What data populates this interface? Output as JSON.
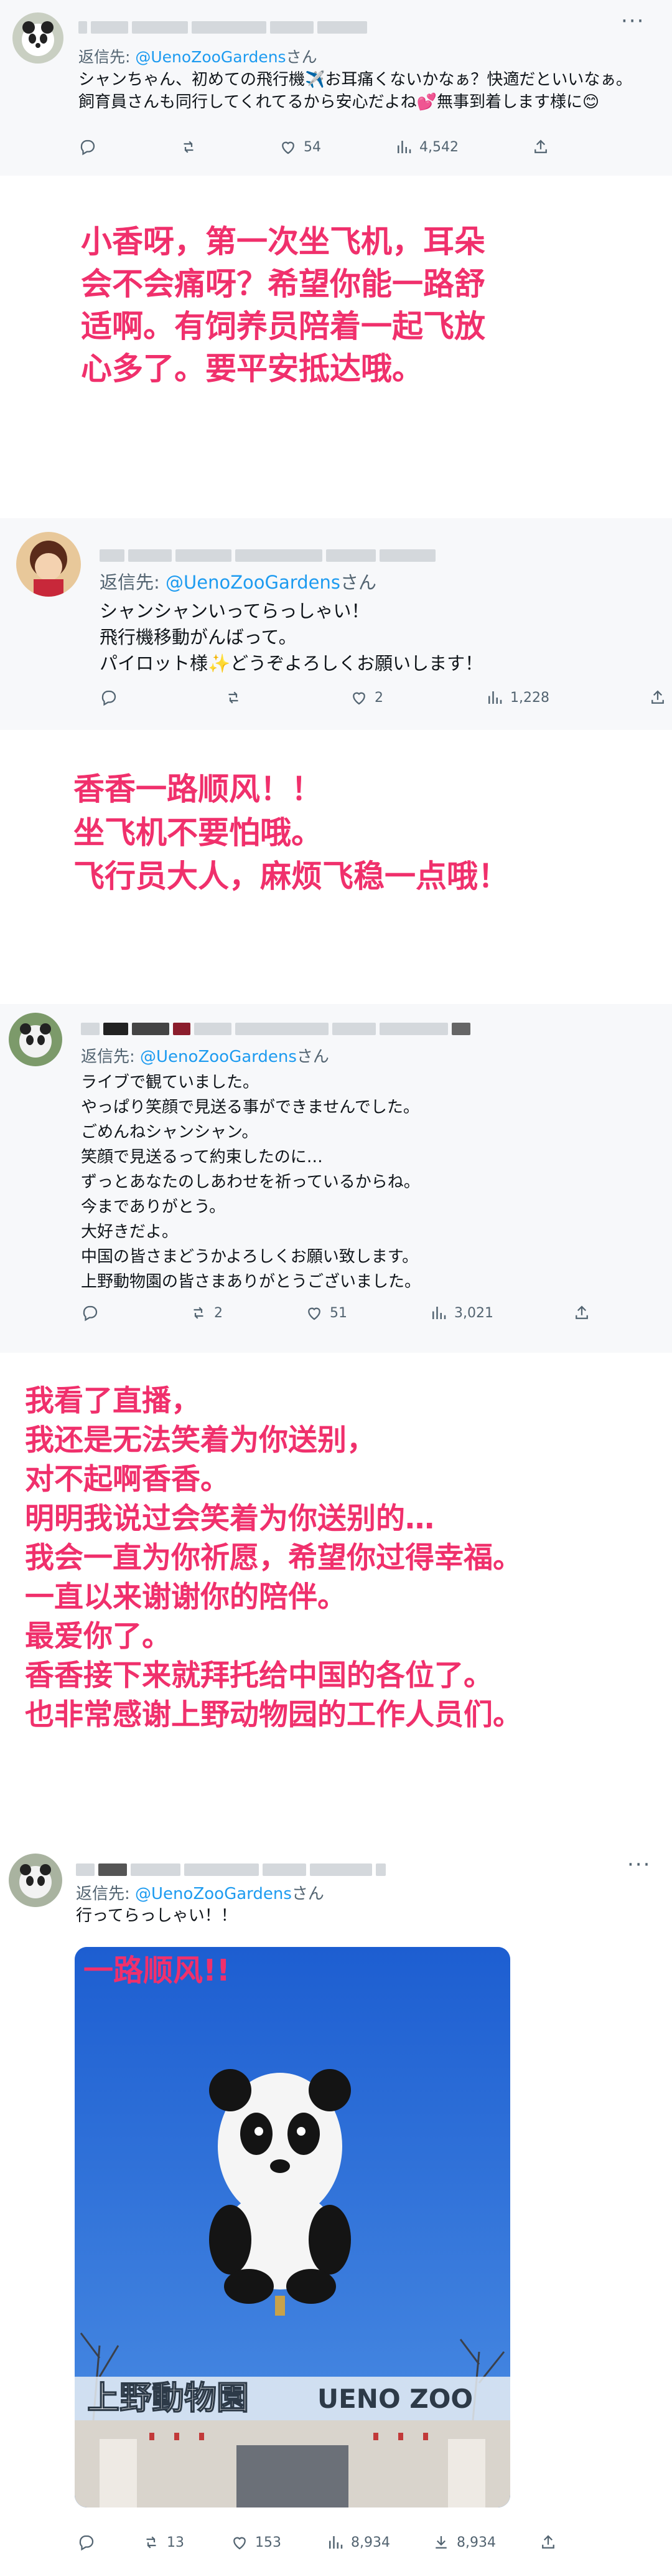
{
  "tweets": [
    {
      "reply_prefix": "返信先: ",
      "reply_handle": "@UenoZooGardens",
      "reply_suffix": "さん",
      "body": "シャンちゃん、初めての飛行機✈️お耳痛くないかなぁ？快適だといいなぁ。飼育員さんも同行してくれてるから安心だよね💕無事到着します様に😊",
      "more": "···",
      "replies": "",
      "retweets": "",
      "likes": "54",
      "views": "4,542"
    },
    {
      "reply_prefix": "返信先: ",
      "reply_handle": "@UenoZooGardens",
      "reply_suffix": "さん",
      "body": "シャンシャンいってらっしゃい！\n飛行機移動がんばって。\nパイロット様✨どうぞよろしくお願いします！",
      "replies": "",
      "retweets": "",
      "likes": "2",
      "views": "1,228"
    },
    {
      "reply_prefix": "返信先: ",
      "reply_handle": "@UenoZooGardens",
      "reply_suffix": "さん",
      "body": "ライブで観ていました。\nやっぱり笑顔で見送る事ができませんでした。\nごめんねシャンシャン。\n笑顔で見送るって約束したのに…\nずっとあなたのしあわせを祈っているからね。\n今までありがとう。\n大好きだよ。\n中国の皆さまどうかよろしくお願い致します。\n上野動物園の皆さまありがとうございました。",
      "replies": "",
      "retweets": "2",
      "likes": "51",
      "views": "3,021"
    },
    {
      "reply_prefix": "返信先: ",
      "reply_handle": "@UenoZooGardens",
      "reply_suffix": "さん",
      "body": "行ってらっしゃい！！",
      "more": "···",
      "overlay": "一路顺风!!",
      "sign_text": "上野動物園",
      "sign_text_en": "UENO ZOO",
      "replies": "",
      "retweets": "13",
      "likes": "153",
      "views": "8,934",
      "downloads": "8,934"
    }
  ],
  "captions": [
    "小香呀，第一次坐飞机，耳朵\n会不会痛呀？希望你能一路舒\n适啊。有饲养员陪着一起飞放\n心多了。要平安抵达哦。",
    "香香一路顺风！！\n坐飞机不要怕哦。\n飞行员大人，麻烦飞稳一点哦！",
    "我看了直播，\n我还是无法笑着为你送别，\n对不起啊香香。\n明明我说过会笑着为你送别的…\n我会一直为你祈愿，希望你过得幸福。\n一直以来谢谢你的陪伴。\n最爱你了。\n香香接下来就拜托给中国的各位了。\n也非常感谢上野动物园的工作人员们。"
  ],
  "colors": {
    "caption": "#f0306c",
    "handle": "#1d9bf0",
    "meta": "#536471",
    "sky": "#2a6fd6"
  }
}
